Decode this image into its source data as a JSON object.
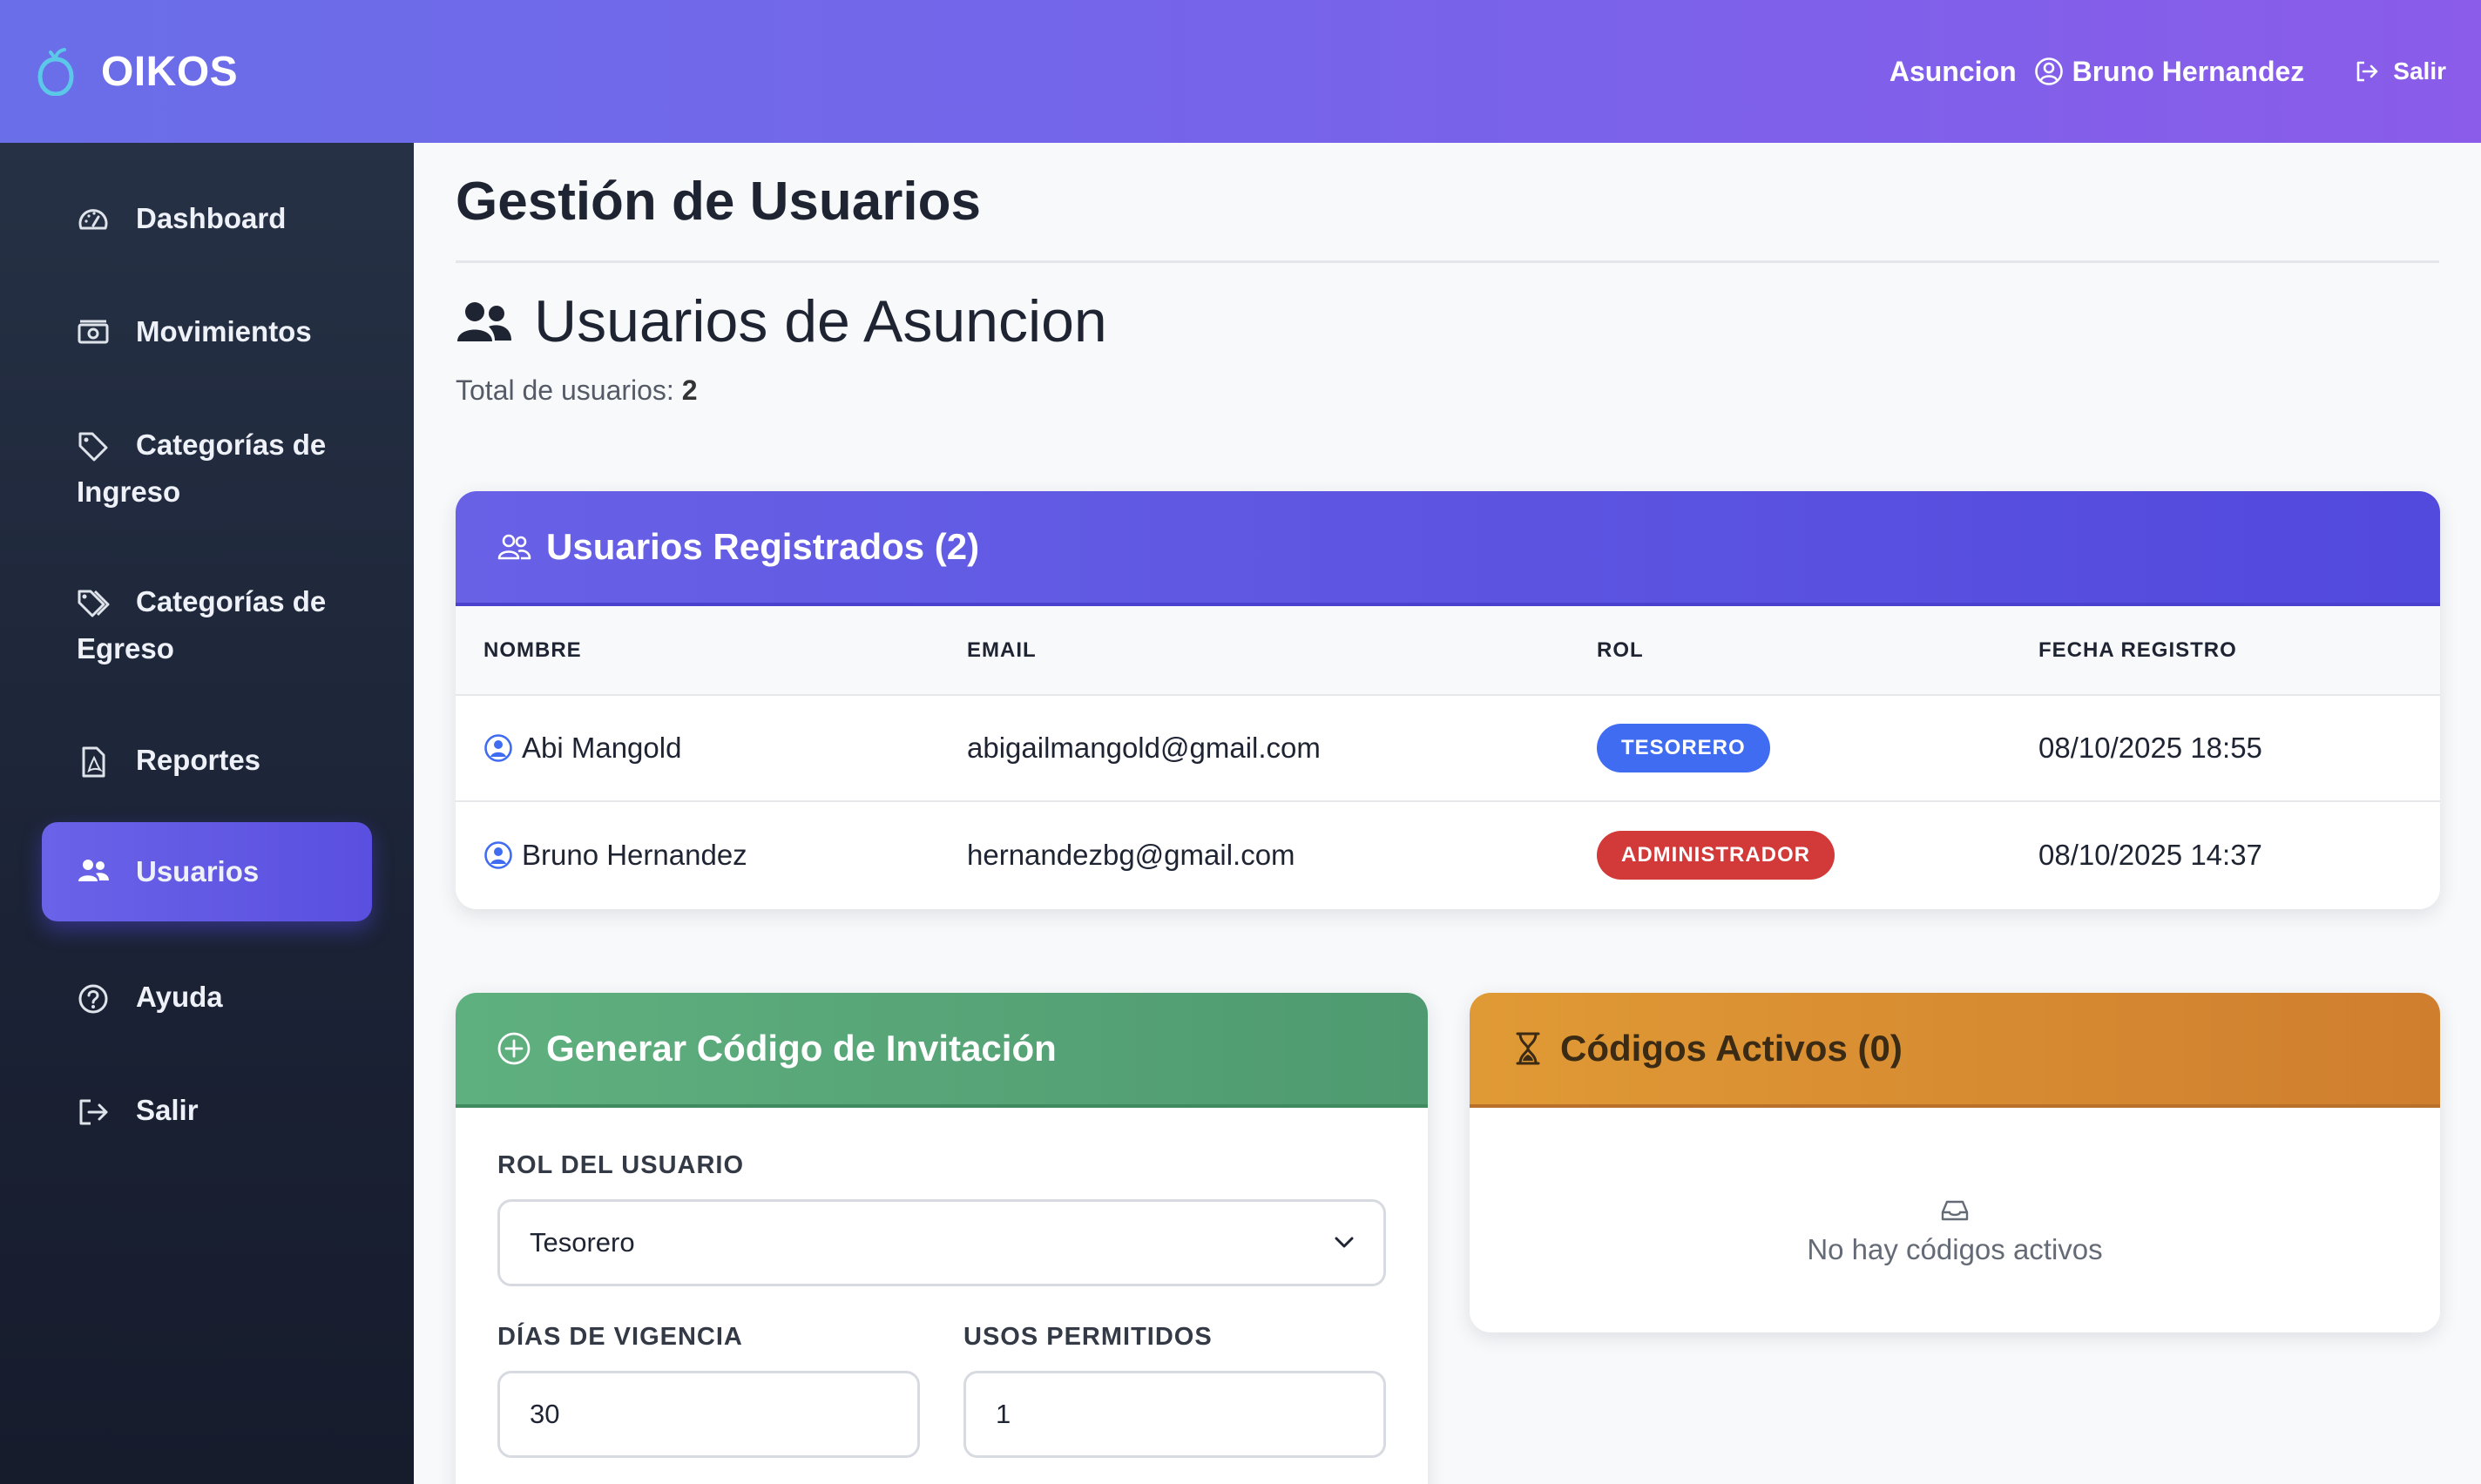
{
  "header": {
    "brand": "OIKOS",
    "location": "Asuncion",
    "user_name": "Bruno Hernandez",
    "logout_label": "Salir"
  },
  "sidebar": {
    "items": [
      {
        "label": "Dashboard",
        "icon": "gauge-icon"
      },
      {
        "label": "Movimientos",
        "icon": "cash-icon"
      },
      {
        "label": "Categorías de Ingreso",
        "icon": "tag-icon"
      },
      {
        "label": "Categorías de Egreso",
        "icon": "tags-icon"
      },
      {
        "label": "Reportes",
        "icon": "pdf-file-icon"
      },
      {
        "label": "Usuarios",
        "icon": "people-icon",
        "active": true
      },
      {
        "label": "Ayuda",
        "icon": "question-circle-icon"
      },
      {
        "label": "Salir",
        "icon": "logout-icon"
      }
    ]
  },
  "main": {
    "page_title": "Gestión de Usuarios",
    "section_title": "Usuarios de Asuncion",
    "total_label": "Total de usuarios:",
    "total_value": "2"
  },
  "users_card": {
    "title": "Usuarios Registrados (2)",
    "columns": [
      "NOMBRE",
      "EMAIL",
      "ROL",
      "FECHA REGISTRO"
    ],
    "rows": [
      {
        "name": "Abi Mangold",
        "email": "abigailmangold@gmail.com",
        "role": "TESORERO",
        "date": "08/10/2025 18:55"
      },
      {
        "name": "Bruno Hernandez",
        "email": "hernandezbg@gmail.com",
        "role": "ADMINISTRADOR",
        "date": "08/10/2025 14:37"
      }
    ]
  },
  "invite_card": {
    "title": "Generar Código de Invitación",
    "role_label": "ROL DEL USUARIO",
    "role_value": "Tesorero",
    "days_label": "DÍAS DE VIGENCIA",
    "days_value": "30",
    "uses_label": "USOS PERMITIDOS",
    "uses_value": "1"
  },
  "active_card": {
    "title": "Códigos Activos (0)",
    "empty_text": "No hay códigos activos"
  },
  "colors": {
    "header_gradient_start": "#6a6ee8",
    "header_gradient_end": "#8a5ce9",
    "sidebar_bg": "#1b2235",
    "active_item": "#5a4fe0",
    "users_head": "#5a52e0",
    "invite_head": "#58a577",
    "active_head": "#d88c31",
    "badge_tesorero": "#3f6cf0",
    "badge_admin": "#d23a3a"
  }
}
